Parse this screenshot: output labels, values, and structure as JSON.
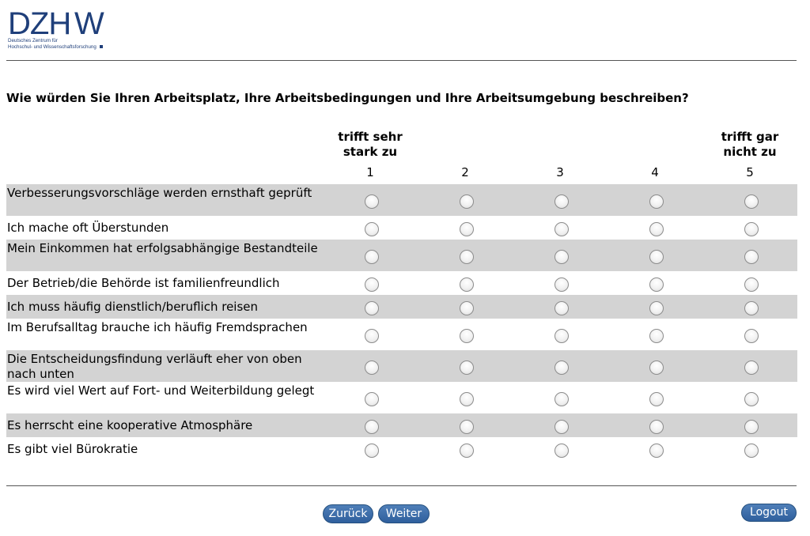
{
  "logo": {
    "text": "DZHW",
    "subtitle_line1": "Deutsches Zentrum für",
    "subtitle_line2": "Hochschul- und Wissenschaftsforschung",
    "color": "#1f3f7a"
  },
  "question": "Wie würden Sie Ihren Arbeitsplatz, Ihre Arbeitsbedingungen und Ihre Arbeitsumgebung beschreiben?",
  "scale": {
    "left_label_line1": "trifft sehr",
    "left_label_line2": "stark zu",
    "right_label_line1": "trifft gar",
    "right_label_line2": "nicht zu",
    "points": [
      "1",
      "2",
      "3",
      "4",
      "5"
    ]
  },
  "items": [
    {
      "label": "Verbesserungsvorschläge werden ernsthaft geprüft"
    },
    {
      "label": "Ich mache oft Überstunden"
    },
    {
      "label": "Mein Einkommen hat erfolgsabhängige Bestandteile"
    },
    {
      "label": "Der Betrieb/die Behörde ist familienfreundlich"
    },
    {
      "label": "Ich muss häufig dienstlich/beruflich reisen"
    },
    {
      "label": "Im Berufsalltag brauche ich häufig Fremdsprachen"
    },
    {
      "label": "Die Entscheidungsfindung verläuft eher von oben nach unten"
    },
    {
      "label": "Es wird viel Wert auf Fort- und Weiterbildung gelegt"
    },
    {
      "label": "Es herrscht eine kooperative Atmosphäre"
    },
    {
      "label": "Es gibt viel Bürokratie"
    }
  ],
  "buttons": {
    "back": "Zurück",
    "next": "Weiter",
    "logout": "Logout"
  },
  "colors": {
    "shaded_row": "#d3d3d3",
    "button": "#3a6aa8"
  }
}
